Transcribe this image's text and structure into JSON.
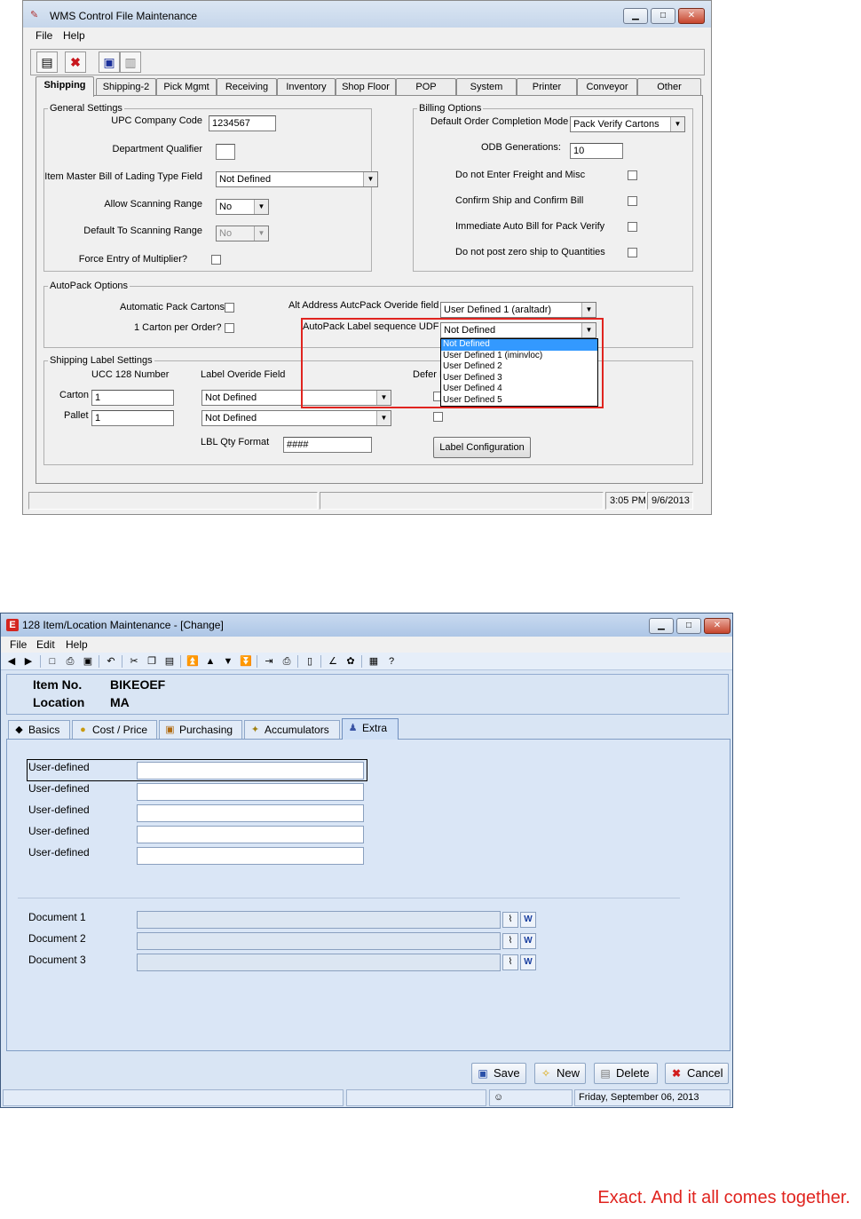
{
  "wms": {
    "title": "WMS Control File Maintenance",
    "menu": [
      "File",
      "Help"
    ],
    "tabs": [
      "Shipping",
      "Shipping-2",
      "Pick Mgmt",
      "Receiving",
      "Inventory",
      "Shop Floor",
      "POP",
      "System",
      "Printer",
      "Conveyor",
      "Other"
    ],
    "active_tab": "Shipping",
    "general": {
      "legend": "General Settings",
      "upc_label": "UPC Company Code",
      "upc_value": "1234567",
      "dept_label": "Department Qualifier",
      "dept_value": "",
      "bol_label": "Item Master Bill of Lading Type Field",
      "bol_value": "Not Defined",
      "allow_scan_label": "Allow Scanning Range",
      "allow_scan_value": "No",
      "default_scan_label": "Default To Scanning Range",
      "default_scan_value": "No",
      "force_mult_label": "Force Entry of Multiplier?"
    },
    "billing": {
      "legend": "Billing Options",
      "completion_label": "Default Order Completion Mode",
      "completion_value": "Pack Verify Cartons",
      "odb_label": "ODB Generations:",
      "odb_value": "10",
      "freight_label": "Do not Enter Freight and Misc",
      "confirm_label": "Confirm Ship and Confirm Bill",
      "autobill_label": "Immediate Auto Bill for Pack Verify",
      "zero_ship_label": "Do not post zero ship to Quantities"
    },
    "autopack": {
      "legend": "AutoPack Options",
      "auto_cartons_label": "Automatic Pack Cartons",
      "one_carton_label": "1  Carton per Order?",
      "alt_addr_label": "Alt Address AutcPack Overide field",
      "alt_addr_value": "User Defined 1 (araltadr)",
      "seq_label": "AutoPack Label sequence UDF",
      "seq_value": "Not Defined",
      "options": [
        "Not Defined",
        "User Defined 1 (iminvloc)",
        "User Defined 2",
        "User Defined 3",
        "User Defined 4",
        "User Defined 5"
      ]
    },
    "shiplabel": {
      "legend": "Shipping Label Settings",
      "ucc_header": "UCC 128 Number",
      "override_header": "Label Overide Field",
      "defer_header": "Defer P",
      "carton_label": "Carton",
      "carton_value": "1",
      "carton_override": "Not Defined",
      "pallet_label": "Pallet",
      "pallet_value": "1",
      "pallet_override": "Not Defined",
      "qty_format_label": "LBL Qty Format",
      "qty_format_value": "####",
      "label_config_button": "Label Configuration"
    },
    "status": {
      "time": "3:05 PM",
      "date": "9/6/2013"
    }
  },
  "item": {
    "title": "128 Item/Location Maintenance - [Change]",
    "menu": [
      "File",
      "Edit",
      "Help"
    ],
    "header": {
      "item_label": "Item No.",
      "item_value": "BIKEOEF",
      "location_label": "Location",
      "location_value": "MA"
    },
    "tabs": [
      "Basics",
      "Cost / Price",
      "Purchasing",
      "Accumulators",
      "Extra"
    ],
    "active_tab": "Extra",
    "user_defined": [
      "User-defined",
      "User-defined",
      "User-defined",
      "User-defined",
      "User-defined"
    ],
    "documents": [
      "Document 1",
      "Document 2",
      "Document 3"
    ],
    "buttons": {
      "save": "Save",
      "new": "New",
      "delete": "Delete",
      "cancel": "Cancel"
    },
    "status": {
      "date": "Friday, September 06, 2013"
    }
  },
  "tagline": "Exact. And it all comes together."
}
